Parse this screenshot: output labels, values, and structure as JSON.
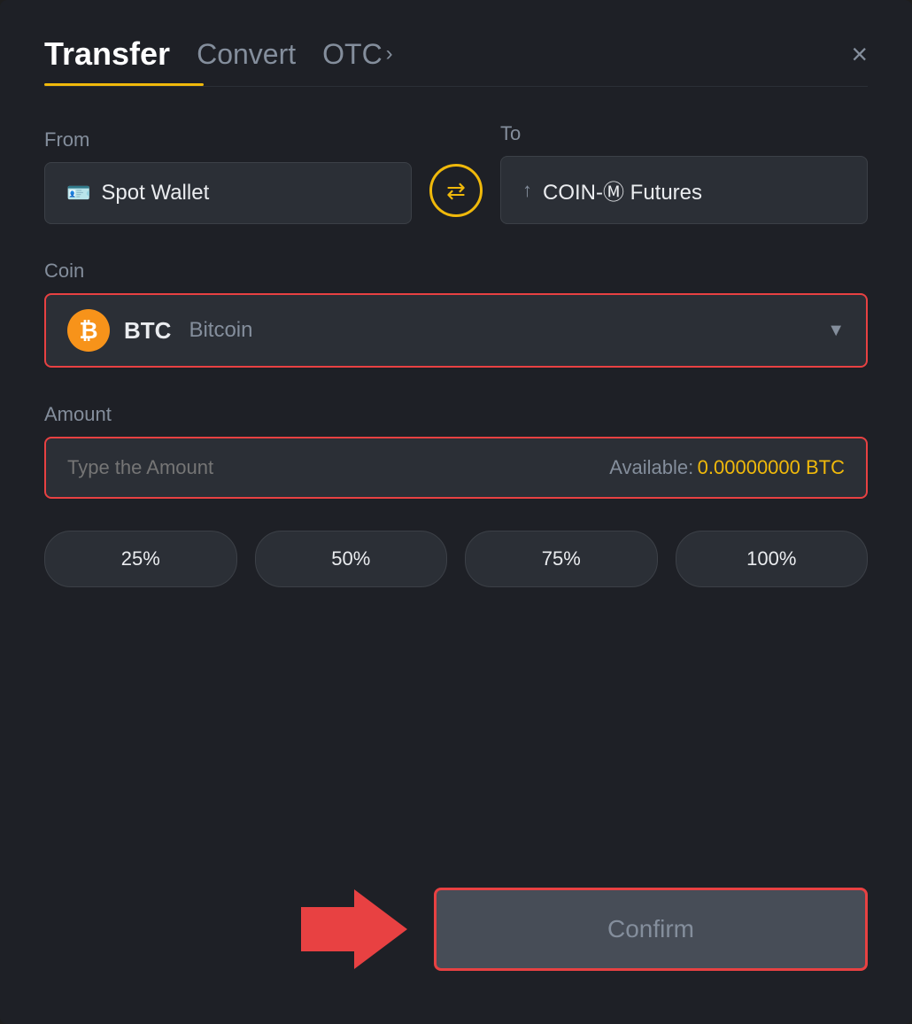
{
  "modal": {
    "title": "Transfer"
  },
  "header": {
    "tab_transfer": "Transfer",
    "tab_convert": "Convert",
    "tab_otc": "OTC",
    "close_label": "×"
  },
  "from": {
    "label": "From",
    "wallet_label": "Spot Wallet"
  },
  "to": {
    "label": "To",
    "wallet_label": "COIN-Ⓜ Futures"
  },
  "coin": {
    "label": "Coin",
    "symbol": "BTC",
    "name": "Bitcoin"
  },
  "amount": {
    "label": "Amount",
    "placeholder": "Type the Amount",
    "available_label": "Available:",
    "available_value": "0.00000000 BTC"
  },
  "percentages": [
    {
      "label": "25%"
    },
    {
      "label": "50%"
    },
    {
      "label": "75%"
    },
    {
      "label": "100%"
    }
  ],
  "confirm_button": "Confirm"
}
